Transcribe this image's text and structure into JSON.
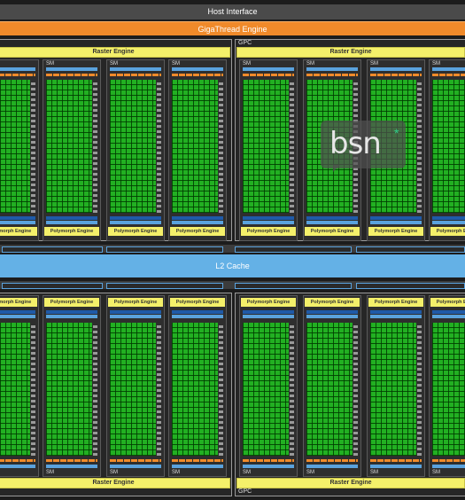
{
  "host_interface": "Host Interface",
  "gigathread_engine": "GigaThread Engine",
  "l2_cache": "L2 Cache",
  "gpc_label": "GPC",
  "raster_engine": "Raster Engine",
  "sm_label": "SM",
  "polymorph_engine": "Polymorph Engine",
  "watermark": {
    "text": "bsn",
    "mark": "*"
  },
  "colors": {
    "orange": "#f08a2a",
    "green_core": "#22b022",
    "blue": "#5aa2dd",
    "yellow": "#f4f06a",
    "l2_blue": "#64b1e6"
  }
}
